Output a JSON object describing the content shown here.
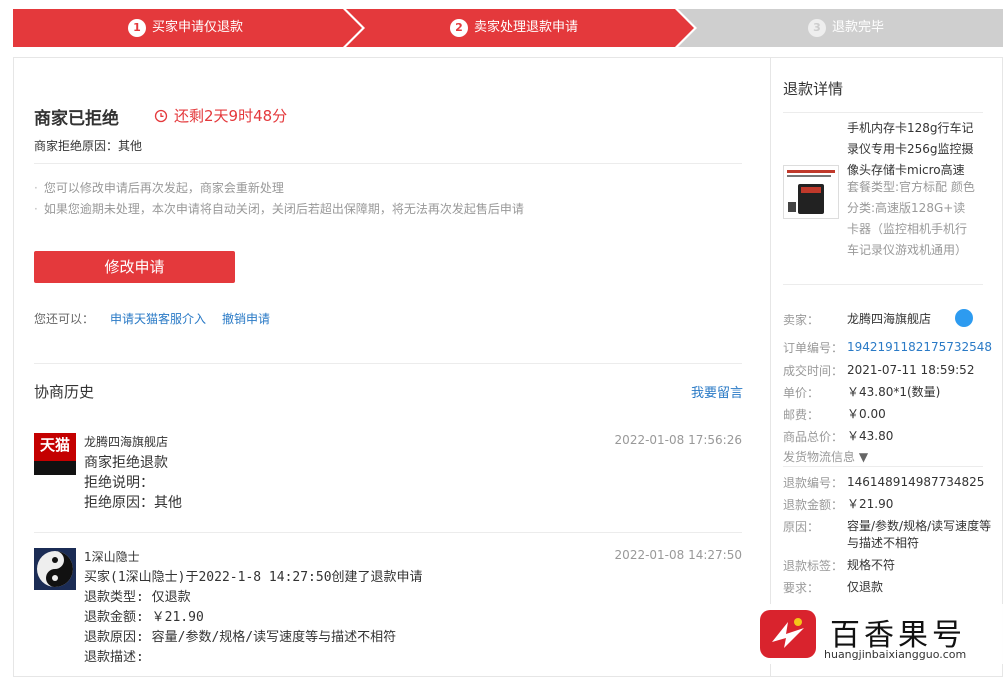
{
  "steps": [
    {
      "num": "1",
      "label": "买家申请仅退款"
    },
    {
      "num": "2",
      "label": "卖家处理退款申请"
    },
    {
      "num": "3",
      "label": "退款完毕"
    }
  ],
  "colors": {
    "accent": "#e4393c",
    "link": "#2a7ac6",
    "inactive_step": "#cfcfcf"
  },
  "status": {
    "title": "商家已拒绝",
    "countdown": "还剩2天9时48分",
    "reason": "商家拒绝原因：其他",
    "tips": [
      "您可以修改申请后再次发起，商家会重新处理",
      "如果您逾期未处理，本次申请将自动关闭，关闭后若超出保障期，将无法再次发起售后申请"
    ],
    "modify_button": "修改申请",
    "more_label": "您还可以：",
    "link_intervene": "申请天猫客服介入",
    "link_cancel": "撤销申请"
  },
  "history": {
    "title": "协商历史",
    "leave_message": "我要留言",
    "entries": [
      {
        "who": "龙腾四海旗舰店",
        "avatar_text": "天猫",
        "time": "2022-01-08 17:56:26",
        "lines": [
          "商家拒绝退款",
          "拒绝说明：",
          "拒绝原因：其他"
        ]
      },
      {
        "who": "1深山隐士",
        "time": "2022-01-08 14:27:50",
        "lines": [
          "买家(1深山隐士)于2022-1-8 14:27:50创建了退款申请",
          "退款类型: 仅退款",
          "退款金额: ￥21.90",
          "退款原因: 容量/参数/规格/读写速度等与描述不相符",
          "退款描述:"
        ]
      }
    ]
  },
  "detail": {
    "title": "退款详情",
    "product_name": "手机内存卡128g行车记录仪专用卡256g监控摄像头存储卡micro高速",
    "product_specs": "套餐类型:官方标配 颜色分类:高速版128G+读卡器（监控相机手机行车记录仪游戏机通用）",
    "seller_label": "卖家：",
    "seller": "龙腾四海旗舰店",
    "order_no_label": "订单编号：",
    "order_no": "1942191182175732548",
    "deal_time_label": "成交时间：",
    "deal_time": "2021-07-11 18:59:52",
    "price_label": "单价：",
    "price": "￥43.80*1(数量)",
    "postage_label": "邮费：",
    "postage": "￥0.00",
    "total_label": "商品总价：",
    "total": "￥43.80",
    "logistics_label": "发货物流信息",
    "refund_no_label": "退款编号：",
    "refund_no": "146148914987734825",
    "refund_amount_label": "退款金额：",
    "refund_amount": "￥21.90",
    "reason_label": "原因：",
    "reason": "容量/参数/规格/读写速度等与描述不相符",
    "tag_label": "退款标签：",
    "tag": "规格不符",
    "require_label": "要求：",
    "require": "仅退款"
  },
  "watermark": {
    "brand": "百香果号",
    "url": "huangjinbaixiangguo.com"
  }
}
